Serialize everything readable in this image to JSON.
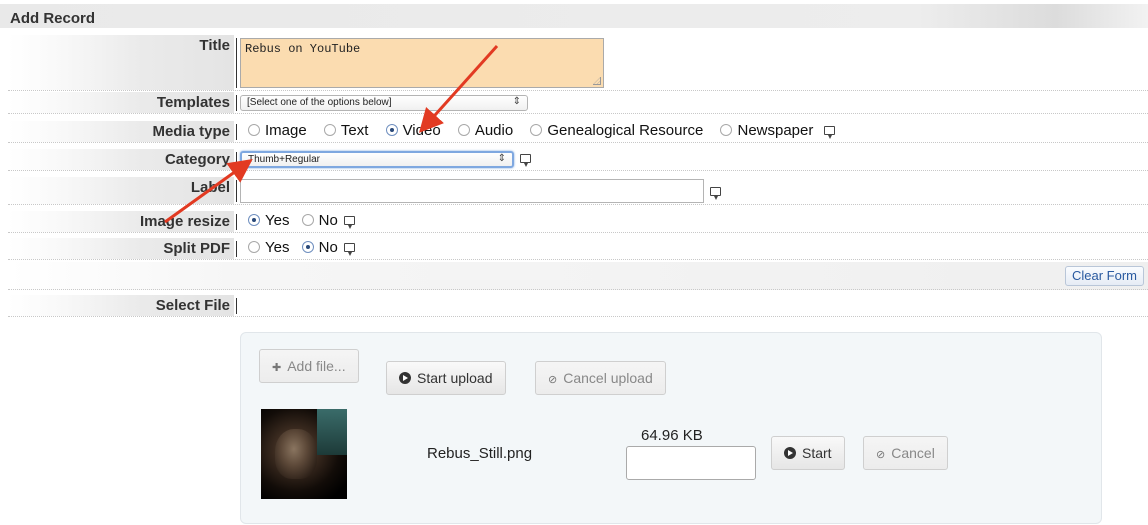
{
  "header": {
    "title": "Add Record"
  },
  "form": {
    "title": {
      "label": "Title",
      "value": "Rebus on YouTube"
    },
    "templates": {
      "label": "Templates",
      "selected": "[Select one of the options below]"
    },
    "media_type": {
      "label": "Media type",
      "options": [
        "Image",
        "Text",
        "Video",
        "Audio",
        "Genealogical Resource",
        "Newspaper"
      ],
      "selected": "Video"
    },
    "category": {
      "label": "Category",
      "selected": "Thumb+Regular"
    },
    "label_field": {
      "label": "Label",
      "value": ""
    },
    "image_resize": {
      "label": "Image resize",
      "options": [
        "Yes",
        "No"
      ],
      "selected": "Yes"
    },
    "split_pdf": {
      "label": "Split PDF",
      "options": [
        "Yes",
        "No"
      ],
      "selected": "No"
    },
    "clear_label": "Clear Form",
    "select_file": {
      "label": "Select File"
    }
  },
  "upload": {
    "add_label": "Add file...",
    "start_upload_label": "Start upload",
    "cancel_upload_label": "Cancel upload",
    "file": {
      "name": "Rebus_Still.png",
      "size": "64.96 KB",
      "start_label": "Start",
      "cancel_label": "Cancel"
    }
  },
  "colors": {
    "title_bg": "#fbdcb0",
    "arrow": "#e23a22",
    "link_blue": "#2a5aa0"
  },
  "icons": [
    "help-bubble-icon",
    "plus-icon",
    "upload-circle-icon",
    "cancel-circle-icon",
    "play-circle-icon"
  ]
}
